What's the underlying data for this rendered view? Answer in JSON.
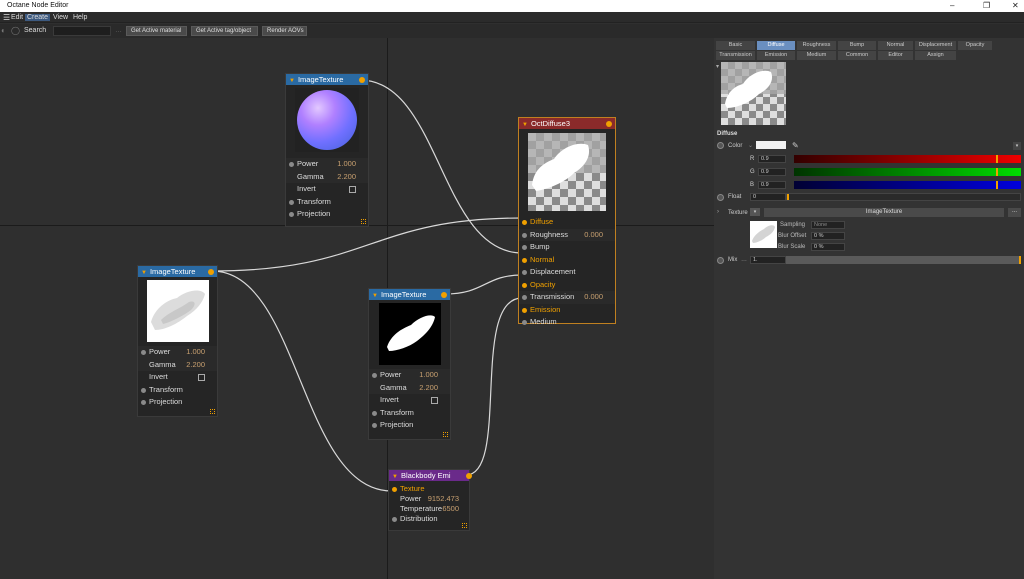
{
  "window": {
    "title": "Octane Node Editor"
  },
  "menu": [
    "Edit",
    "Create",
    "View",
    "Help"
  ],
  "toolbar": {
    "search_label": "Search",
    "get_material": "Get Active material",
    "get_tag": "Get Active tag/object",
    "render_aovs": "Render AOVs"
  },
  "nodes": {
    "tex1": {
      "title": "ImageTexture",
      "power_label": "Power",
      "power": "1.000",
      "gamma_label": "Gamma",
      "gamma": "2.200",
      "invert": "Invert",
      "transform": "Transform",
      "projection": "Projection"
    },
    "tex2": {
      "title": "ImageTexture",
      "power_label": "Power",
      "power": "1.000",
      "gamma_label": "Gamma",
      "gamma": "2.200",
      "invert": "Invert",
      "transform": "Transform",
      "projection": "Projection"
    },
    "tex3": {
      "title": "ImageTexture",
      "power_label": "Power",
      "power": "1.000",
      "gamma_label": "Gamma",
      "gamma": "2.200",
      "invert": "Invert",
      "transform": "Transform",
      "projection": "Projection"
    },
    "diffuse": {
      "title": "OctDiffuse3",
      "diffuse": "Diffuse",
      "roughness": "Roughness",
      "roughness_val": "0.000",
      "bump": "Bump",
      "normal": "Normal",
      "displacement": "Displacement",
      "opacity": "Opacity",
      "transmission": "Transmission",
      "transmission_val": "0.000",
      "emission": "Emission",
      "medium": "Medium"
    },
    "blackbody": {
      "title": "Blackbody Emi",
      "texture": "Texture",
      "power_label": "Power",
      "power": "9152.473",
      "temperature_label": "Temperature",
      "temperature": "6500",
      "distribution": "Distribution"
    }
  },
  "panel": {
    "tabs_row1": [
      "Basic",
      "Diffuse",
      "Roughness",
      "Bump",
      "Normal",
      "Displacement",
      "Opacity"
    ],
    "tabs_row2": [
      "Transmission",
      "Emission",
      "Medium",
      "Common",
      "Editor",
      "Assign"
    ],
    "section": "Diffuse",
    "color_label": "Color",
    "r_label": "R",
    "r_val": "0.9",
    "g_label": "G",
    "g_val": "0.9",
    "b_label": "B",
    "b_val": "0.9",
    "float_label": "Float",
    "float_val": "0",
    "texture_label": "Texture",
    "texture_name": "ImageTexture",
    "more": "...",
    "sampling_label": "Sampling",
    "sampling_val": "None",
    "blur_offset_label": "Blur Offset",
    "blur_offset_val": "0 %",
    "blur_scale_label": "Blur Scale",
    "blur_scale_val": "0 %",
    "mix_label": "Mix",
    "mix_val": "1."
  },
  "colors": {
    "accent": "#f0a000",
    "node_header": "#2a6aa3",
    "material_header": "#8a2a2a",
    "emission_header": "#6a2a8a",
    "wire": "#d9d9d9"
  }
}
